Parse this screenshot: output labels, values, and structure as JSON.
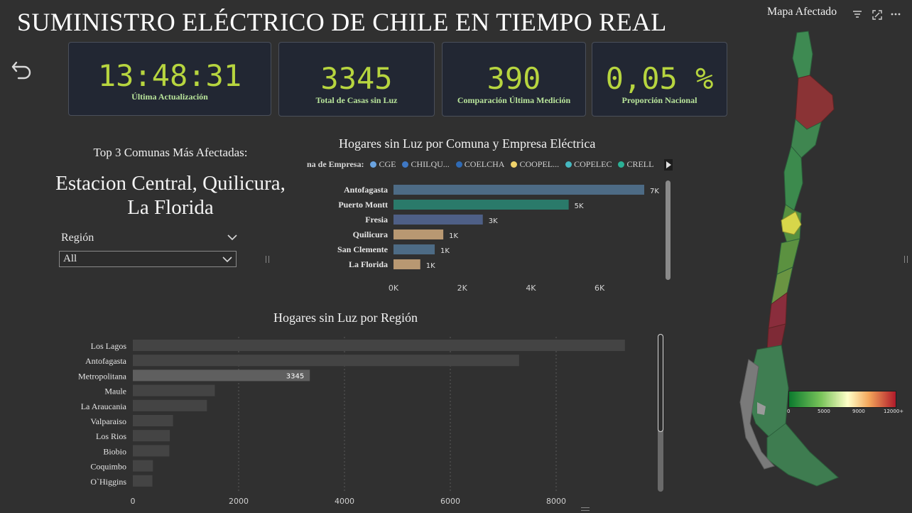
{
  "header": {
    "title": "SUMINISTRO ELÉCTRICO DE CHILE EN TIEMPO REAL"
  },
  "kpis": [
    {
      "value": "13:48:31",
      "label": "Última Actualización"
    },
    {
      "value": "3345",
      "label": "Total de Casas sin Luz"
    },
    {
      "value": "390",
      "label": "Comparación Última Medición"
    },
    {
      "value": "0,05 %",
      "label": "Proporción Nacional"
    }
  ],
  "top3": {
    "heading": "Top 3 Comunas Más Afectadas:",
    "line1": "Estacion Central, Quilicura,",
    "line2": "La Florida"
  },
  "slicer": {
    "label": "Región",
    "selected": "All"
  },
  "map": {
    "title": "Mapa Afectado",
    "scale_labels": [
      "0",
      "5000",
      "9000",
      "12000+"
    ]
  },
  "colors": {
    "cge": "#6aa3e0",
    "chilquinta": "#3f78c4",
    "coelcha": "#2f6ab4",
    "coopelan": "#f0d36b",
    "copelec": "#45b8c0",
    "crell": "#2bb196",
    "bar_slate": "#4d6b85",
    "bar_teal": "#2a7a6a",
    "bar_blue": "#4e5f86",
    "bar_tan": "#b89872",
    "region_bar": "#444444",
    "region_bar_hl": "#5f5f5f",
    "kpi_value": "#b7d53f"
  },
  "charts": {
    "comuna": {
      "title": "Hogares sin Luz por Comuna y Empresa Eléctrica",
      "legend_title": "na de Empresa:",
      "legend": [
        {
          "name": "CGE",
          "color": "#6aa3e0"
        },
        {
          "name": "CHILQU...",
          "color": "#3f78c4"
        },
        {
          "name": "COELCHA",
          "color": "#2f6ab4"
        },
        {
          "name": "COOPEL...",
          "color": "#f0d36b"
        },
        {
          "name": "COPELEC",
          "color": "#45b8c0"
        },
        {
          "name": "CRELL",
          "color": "#2bb196"
        }
      ]
    },
    "region": {
      "title": "Hogares sin Luz por Región"
    }
  },
  "chart_data": [
    {
      "type": "bar",
      "orientation": "horizontal",
      "title": "Hogares sin Luz por Comuna y Empresa Eléctrica",
      "categories": [
        "Antofagasta",
        "Puerto Montt",
        "Fresia",
        "Quilicura",
        "San Clemente",
        "La Florida"
      ],
      "values": [
        7300,
        5100,
        2600,
        1450,
        1200,
        780
      ],
      "data_labels": [
        "7K",
        "5K",
        "3K",
        "1K",
        "1K",
        "1K"
      ],
      "bar_colors": [
        "#4d6b85",
        "#2a7a6a",
        "#4e5f86",
        "#b89872",
        "#4d6b85",
        "#b89872"
      ],
      "xticks": [
        "0K",
        "2K",
        "4K",
        "6K"
      ],
      "xlim": [
        0,
        7300
      ],
      "legend_placement": "top"
    },
    {
      "type": "bar",
      "orientation": "horizontal",
      "title": "Hogares sin Luz por Región",
      "categories": [
        "Los Lagos",
        "Antofagasta",
        "Metropolitana",
        "Maule",
        "La Araucania",
        "Valparaiso",
        "Los Rios",
        "Biobio",
        "Coquimbo",
        "O`Higgins"
      ],
      "values": [
        9300,
        7300,
        3345,
        1550,
        1400,
        760,
        700,
        690,
        380,
        370
      ],
      "highlight_label": "3345",
      "xticks": [
        "0",
        "2000",
        "4000",
        "6000",
        "8000"
      ],
      "xlim": [
        0,
        10000
      ],
      "grid": true
    }
  ]
}
